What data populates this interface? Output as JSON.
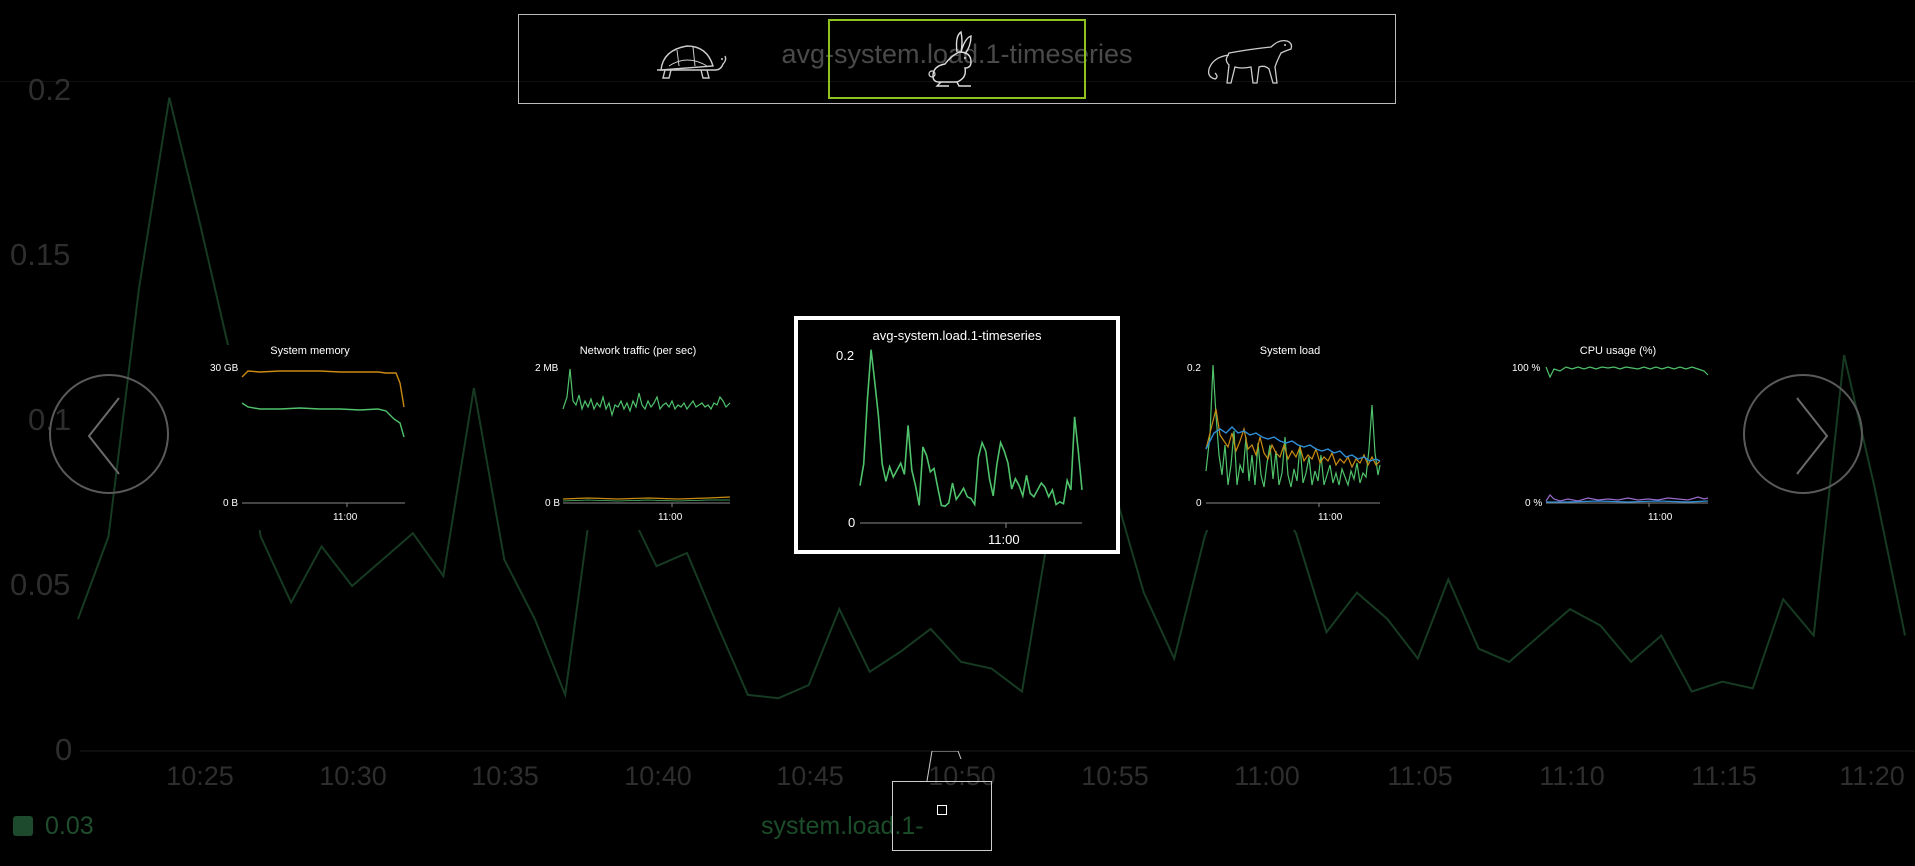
{
  "background_chart": {
    "y_ticks": [
      "0.2",
      "0.15",
      "0.1",
      "0.05",
      "0"
    ],
    "x_ticks": [
      "10:25",
      "10:30",
      "10:35",
      "10:40",
      "10:45",
      "10:50",
      "10:55",
      "11:00",
      "11:05",
      "11:10",
      "11:15",
      "11:20"
    ],
    "legend_value": "0.03",
    "legend_series_name": "system.load.1-",
    "line_color": "#163a22"
  },
  "chart_data": [
    {
      "type": "line",
      "title": "avg-system.load.1-timeseries",
      "x": [
        "10:21",
        "10:22",
        "10:23",
        "10:24",
        "10:25",
        "10:26",
        "10:27",
        "10:28",
        "10:29",
        "10:30",
        "10:31",
        "10:32",
        "10:33",
        "10:34",
        "10:35",
        "10:36",
        "10:37",
        "10:38",
        "10:39",
        "10:40",
        "10:41",
        "10:42",
        "10:43",
        "10:44",
        "10:45",
        "10:46",
        "10:47",
        "10:48",
        "10:49",
        "10:50",
        "10:51",
        "10:52",
        "10:53",
        "10:54",
        "10:55",
        "10:56",
        "10:57",
        "10:58",
        "10:59",
        "11:00",
        "11:01",
        "11:02",
        "11:03",
        "11:04",
        "11:05",
        "11:06",
        "11:07",
        "11:08",
        "11:09",
        "11:10",
        "11:11",
        "11:12",
        "11:13",
        "11:14",
        "11:15",
        "11:16",
        "11:17",
        "11:18",
        "11:19",
        "11:20",
        "11:21"
      ],
      "series": [
        {
          "values": [
            0.04,
            0.065,
            0.14,
            0.198,
            0.16,
            0.12,
            0.065,
            0.045,
            0.062,
            0.05,
            0.058,
            0.066,
            0.053,
            0.11,
            0.058,
            0.04,
            0.017,
            0.085,
            0.075,
            0.056,
            0.06,
            0.038,
            0.017,
            0.016,
            0.02,
            0.043,
            0.024,
            0.03,
            0.037,
            0.027,
            0.025,
            0.018,
            0.073,
            0.09,
            0.08,
            0.048,
            0.028,
            0.065,
            0.09,
            0.08,
            0.066,
            0.036,
            0.048,
            0.04,
            0.028,
            0.052,
            0.031,
            0.027,
            0.035,
            0.043,
            0.038,
            0.027,
            0.035,
            0.018,
            0.021,
            0.019,
            0.046,
            0.035,
            0.12,
            0.08,
            0.035
          ]
        }
      ],
      "ylim": [
        0,
        0.2
      ]
    }
  ],
  "speed_selector": {
    "title": "avg-system.load.1-timeseries",
    "options": [
      {
        "name": "slow",
        "icon": "turtle-icon",
        "selected": false
      },
      {
        "name": "normal",
        "icon": "rabbit-icon",
        "selected": true
      },
      {
        "name": "fast",
        "icon": "cheetah-icon",
        "selected": false
      }
    ],
    "accent": "#8ec21f"
  },
  "thumbnails": {
    "memory": {
      "title": "System memory",
      "y_top": "30 GB",
      "y_bottom": "0 B",
      "x_tick": "11:00"
    },
    "network": {
      "title": "Network traffic (per sec)",
      "y_top": "2 MB",
      "y_bottom": "0 B",
      "x_tick": "11:00"
    },
    "active": {
      "title": "avg-system.load.1-timeseries",
      "y_top": "0.2",
      "y_bottom": "0",
      "x_tick": "11:00"
    },
    "load": {
      "title": "System load",
      "y_top": "0.2",
      "y_bottom": "0",
      "x_tick": "11:00"
    },
    "cpu": {
      "title": "CPU usage (%)",
      "y_top": "100 %",
      "y_bottom": "0 %",
      "x_tick": "11:00"
    }
  },
  "colors": {
    "green": "#4fc26b",
    "orange": "#c98b12",
    "blue": "#2f8fd8",
    "purple": "#9a6bc9",
    "axis": "#888888"
  },
  "navigation": {
    "prev_icon": "chevron-left-icon",
    "next_icon": "chevron-right-icon"
  }
}
